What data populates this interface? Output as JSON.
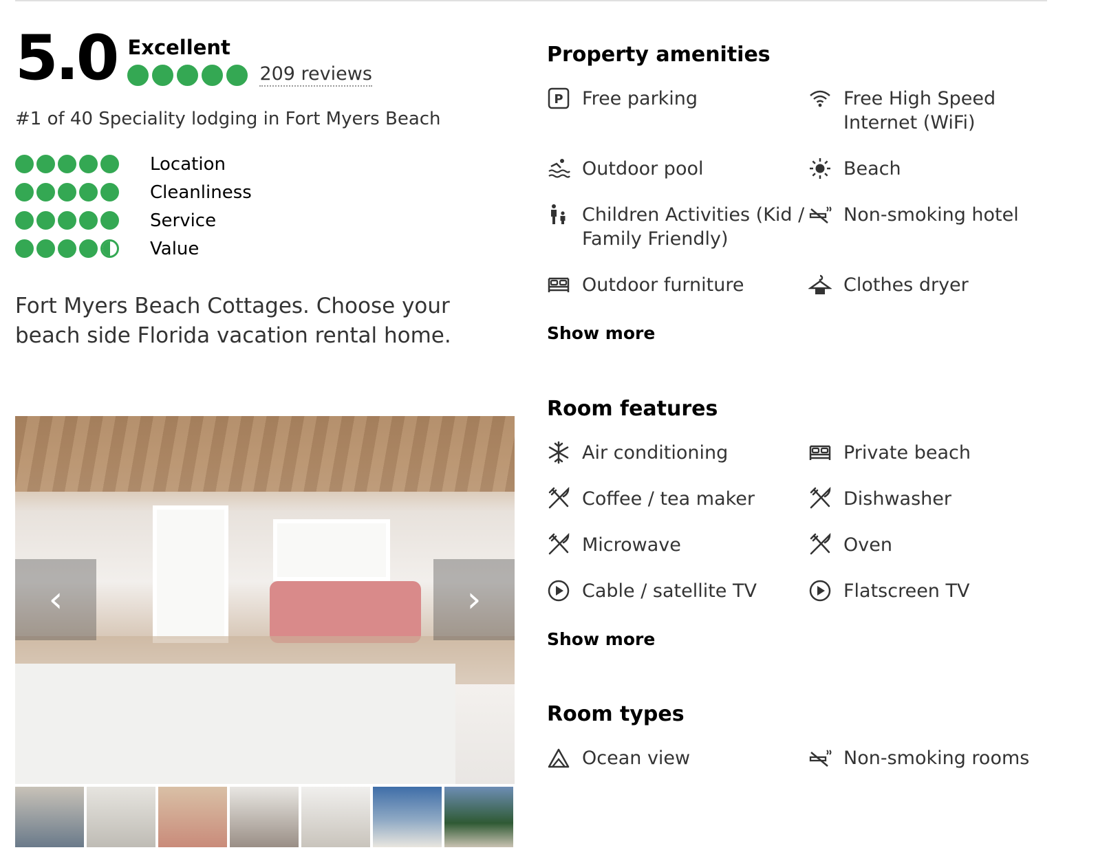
{
  "rating": {
    "score": "5.0",
    "label": "Excellent",
    "bubbles": 5,
    "reviews": "209 reviews",
    "rank": "#1 of 40 Speciality lodging in Fort Myers Beach",
    "accent_color": "#34a853"
  },
  "sub_ratings": [
    {
      "label": "Location",
      "value": 5
    },
    {
      "label": "Cleanliness",
      "value": 5
    },
    {
      "label": "Service",
      "value": 5
    },
    {
      "label": "Value",
      "value": 4.5
    }
  ],
  "description": "Fort Myers Beach Cottages. Choose your beach side Florida vacation rental home.",
  "gallery": {
    "prev_icon": "chevron-left-icon",
    "next_icon": "chevron-right-icon",
    "thumbnails": 7
  },
  "amenities": {
    "title": "Property amenities",
    "items": [
      {
        "label": "Free parking",
        "icon": "parking-icon"
      },
      {
        "label": "Free High Speed Internet (WiFi)",
        "icon": "wifi-icon"
      },
      {
        "label": "Outdoor pool",
        "icon": "pool-icon"
      },
      {
        "label": "Beach",
        "icon": "sun-icon"
      },
      {
        "label": "Children Activities (Kid / Family Friendly)",
        "icon": "family-icon"
      },
      {
        "label": "Non-smoking hotel",
        "icon": "no-smoking-icon"
      },
      {
        "label": "Outdoor furniture",
        "icon": "bed-icon"
      },
      {
        "label": "Clothes dryer",
        "icon": "hanger-icon"
      }
    ],
    "show_more": "Show more"
  },
  "room_features": {
    "title": "Room features",
    "items": [
      {
        "label": "Air conditioning",
        "icon": "snowflake-icon"
      },
      {
        "label": "Private beach",
        "icon": "bed-icon"
      },
      {
        "label": "Coffee / tea maker",
        "icon": "utensils-icon"
      },
      {
        "label": "Dishwasher",
        "icon": "utensils-icon"
      },
      {
        "label": "Microwave",
        "icon": "utensils-icon"
      },
      {
        "label": "Oven",
        "icon": "utensils-icon"
      },
      {
        "label": "Cable / satellite TV",
        "icon": "play-icon"
      },
      {
        "label": "Flatscreen TV",
        "icon": "play-icon"
      }
    ],
    "show_more": "Show more"
  },
  "room_types": {
    "title": "Room types",
    "items": [
      {
        "label": "Ocean view",
        "icon": "mountain-icon"
      },
      {
        "label": "Non-smoking rooms",
        "icon": "no-smoking-icon"
      }
    ]
  }
}
